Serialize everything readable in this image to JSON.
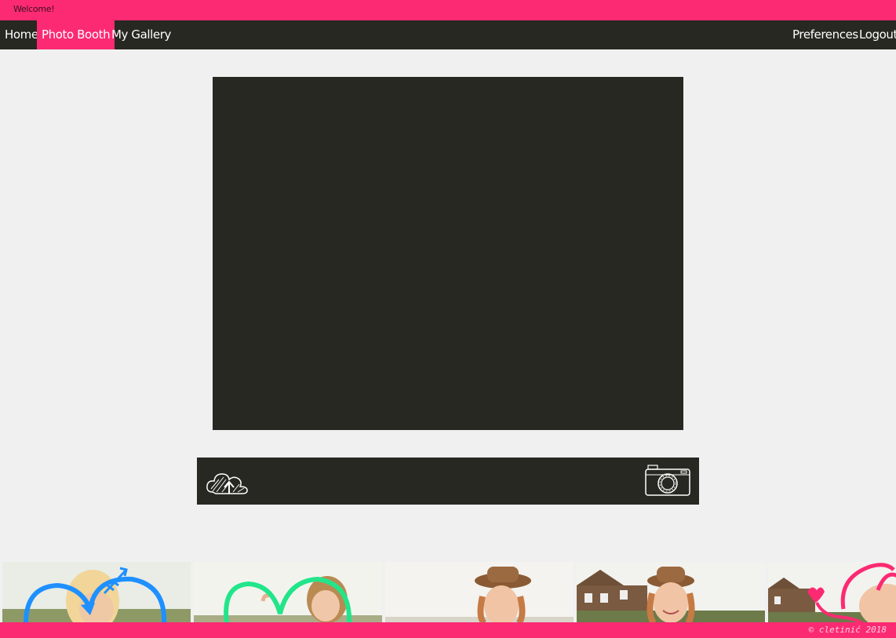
{
  "header": {
    "welcome": "Welcome!"
  },
  "nav": {
    "home": "Home",
    "photo_booth": "Photo Booth",
    "my_gallery": "My Gallery",
    "preferences": "Preferences",
    "logout": "Logout",
    "active": "photo_booth"
  },
  "controls": {
    "upload_icon": "cloud-upload-icon",
    "capture_icon": "camera-icon"
  },
  "filters": [
    {
      "name": "arrows-heart-filter",
      "overlay_color": "#1e90ff"
    },
    {
      "name": "hearts-filter",
      "overlay_color": "#22e58a"
    },
    {
      "name": "hat-filter",
      "overlay_color": ""
    },
    {
      "name": "no-filter",
      "overlay_color": ""
    },
    {
      "name": "cat-ears-filter",
      "overlay_color": "#fc2a72"
    }
  ],
  "footer": {
    "copyright": "© cletinić 2018"
  },
  "colors": {
    "accent": "#fc2a72",
    "dark": "#272822",
    "background": "#f0f0f0"
  }
}
